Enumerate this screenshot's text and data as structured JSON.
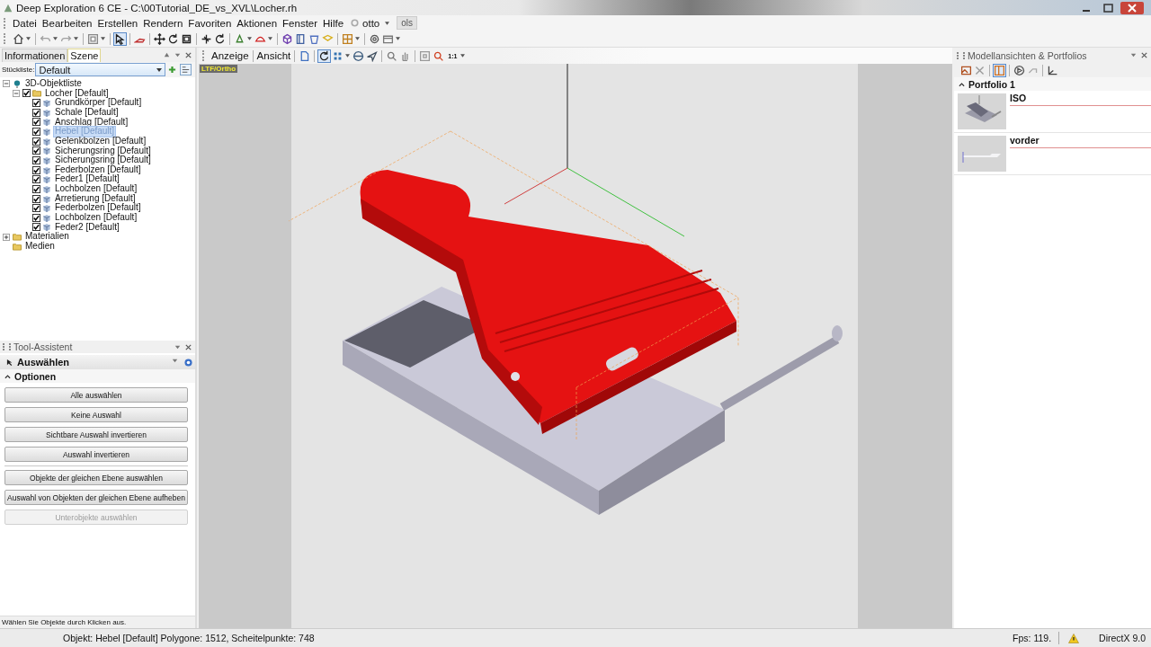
{
  "window": {
    "title": "Deep Exploration 6 CE - C:\\00Tutorial_DE_vs_XVL\\Locher.rh"
  },
  "menu": [
    "Datei",
    "Bearbeiten",
    "Erstellen",
    "Rendern",
    "Favoriten",
    "Aktionen",
    "Fenster",
    "Hilfe"
  ],
  "user_menu": {
    "label": "otto"
  },
  "menu_tab": "ols",
  "scene_panel": {
    "tabs": [
      {
        "label": "Informationen",
        "selected": false
      },
      {
        "label": "Szene",
        "selected": true
      }
    ],
    "list_label": "Stückliste:",
    "list_value": "Default",
    "tree": [
      {
        "label": "3D-Objektliste",
        "kind": "root",
        "expanded": true,
        "selected": false,
        "children": [
          {
            "label": "Locher [Default]",
            "kind": "folder",
            "expanded": true,
            "checked": true,
            "selected": false,
            "children": [
              {
                "label": "Grundkörper [Default]",
                "kind": "part",
                "checked": true,
                "selected": false
              },
              {
                "label": "Schale [Default]",
                "kind": "part",
                "checked": true,
                "selected": false
              },
              {
                "label": "Anschlag [Default]",
                "kind": "part",
                "checked": true,
                "selected": false
              },
              {
                "label": "Hebel [Default]",
                "kind": "part",
                "checked": true,
                "selected": true
              },
              {
                "label": "Gelenkbolzen [Default]",
                "kind": "part",
                "checked": true,
                "selected": false
              },
              {
                "label": "Sicherungsring [Default]",
                "kind": "part",
                "checked": true,
                "selected": false
              },
              {
                "label": "Sicherungsring [Default]",
                "kind": "part",
                "checked": true,
                "selected": false
              },
              {
                "label": "Federbolzen [Default]",
                "kind": "part",
                "checked": true,
                "selected": false
              },
              {
                "label": "Feder1 [Default]",
                "kind": "part",
                "checked": true,
                "selected": false
              },
              {
                "label": "Lochbolzen [Default]",
                "kind": "part",
                "checked": true,
                "selected": false
              },
              {
                "label": "Arretierung [Default]",
                "kind": "part",
                "checked": true,
                "selected": false
              },
              {
                "label": "Federbolzen [Default]",
                "kind": "part",
                "checked": true,
                "selected": false
              },
              {
                "label": "Lochbolzen [Default]",
                "kind": "part",
                "checked": true,
                "selected": false
              },
              {
                "label": "Feder2 [Default]",
                "kind": "part",
                "checked": true,
                "selected": false
              }
            ]
          }
        ]
      },
      {
        "label": "Materialien",
        "kind": "folder",
        "expanded": false,
        "selected": false
      },
      {
        "label": "Medien",
        "kind": "folder",
        "selected": false
      }
    ]
  },
  "tool_assistant": {
    "title": "Tool-Assistent",
    "tool": "Auswählen",
    "section": {
      "label": "Optionen",
      "expanded": true
    },
    "button_groups": [
      [
        {
          "label": "Alle auswählen",
          "disabled": false
        },
        {
          "label": "Keine Auswahl",
          "disabled": false
        },
        {
          "label": "Sichtbare Auswahl invertieren",
          "disabled": false
        },
        {
          "label": "Auswahl invertieren",
          "disabled": false
        }
      ],
      [
        {
          "label": "Objekte der gleichen Ebene auswählen",
          "disabled": false
        },
        {
          "label": "Auswahl von Objekten der gleichen Ebene aufheben",
          "disabled": false
        },
        {
          "label": "Unterobjekte auswählen",
          "disabled": true
        }
      ]
    ],
    "hint": "Wählen Sie Objekte durch Klicken aus."
  },
  "viewport": {
    "toolbar": [
      "Anzeige",
      "Ansicht"
    ],
    "zoom_label": "1:1",
    "camera_label": "LTF/Ortho"
  },
  "views_panel": {
    "title": "Modellansichten & Portfolios",
    "portfolio": {
      "label": "Portfolio 1",
      "expanded": true
    },
    "views": [
      {
        "name": "ISO",
        "kind": "iso"
      },
      {
        "name": "vorder",
        "kind": "front"
      }
    ]
  },
  "status_bar": {
    "object_info": "Objekt: Hebel [Default] Polygone: 1512, Scheitelpunkte: 748",
    "fps": "Fps: 119.",
    "renderer": "DirectX 9.0"
  }
}
